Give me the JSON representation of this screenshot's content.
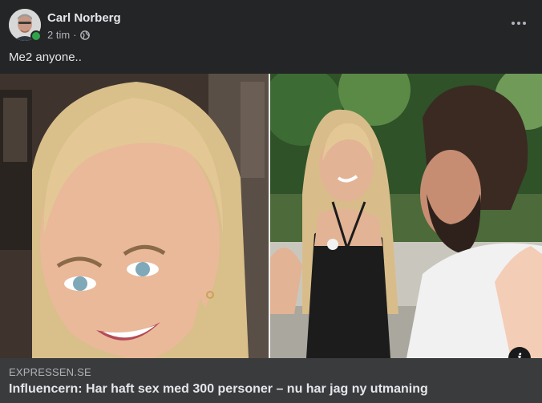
{
  "post": {
    "author": "Carl Norberg",
    "time": "2 tim",
    "separator": "·",
    "privacy_icon": "globe-icon",
    "more_icon": "more-options-icon",
    "text": "Me2 anyone.."
  },
  "link": {
    "domain": "EXPRESSEN.SE",
    "title": "Influencern: Har haft sex med 300 personer – nu har jag ny utmaning",
    "info_icon": "i"
  },
  "colors": {
    "background": "#242526",
    "link_background": "#3a3b3c",
    "online": "#31a24c",
    "text_primary": "#e4e6eb",
    "text_secondary": "#b0b3b8"
  }
}
